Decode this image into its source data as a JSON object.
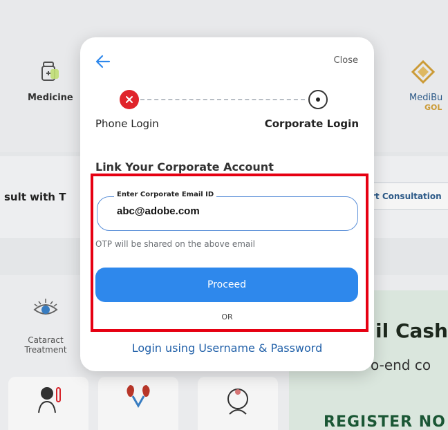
{
  "background": {
    "tiles": {
      "medicine_label": "Medicine",
      "medibuddy_label_1": "MediBu",
      "medibuddy_label_2": "GOL"
    },
    "consult": {
      "text": "sult with T",
      "button_label": "rt Consultation"
    },
    "category": {
      "label": "Cataract Treatment"
    },
    "promo": {
      "title": "il Cash",
      "subtitle": "o-end co",
      "register": "REGISTER NO"
    }
  },
  "modal": {
    "close_label": "Close",
    "steps": {
      "left_label": "Phone Login",
      "right_label": "Corporate Login"
    },
    "section_title": "Link Your Corporate Account",
    "email_field": {
      "legend": "Enter Corporate Email ID",
      "value": "abc@adobe.com"
    },
    "hint": "OTP will be shared on the above email",
    "proceed_label": "Proceed",
    "or_label": "OR",
    "alt_login_label": "Login using Username & Password"
  },
  "colors": {
    "accent": "#2e88ec",
    "step_error": "#e0242b",
    "link": "#1f5fa8",
    "highlight": "#e60012"
  }
}
